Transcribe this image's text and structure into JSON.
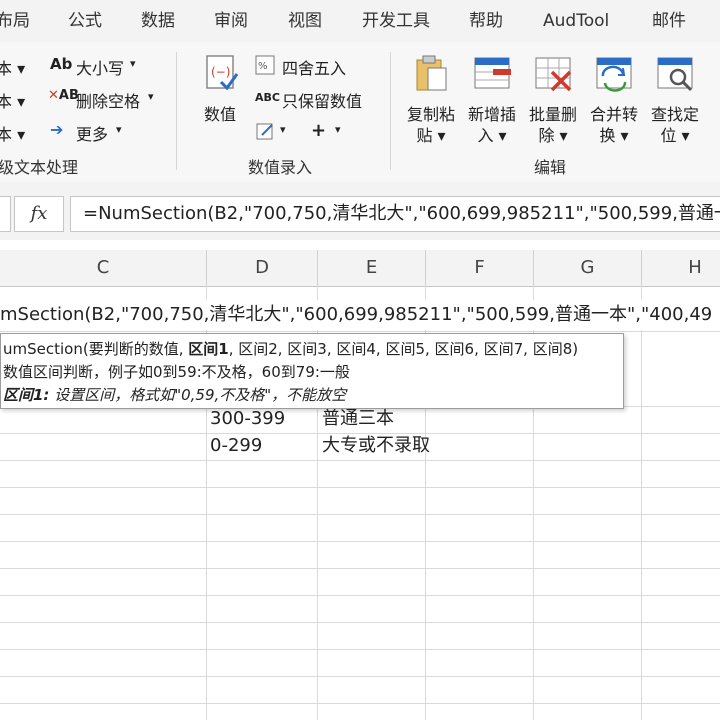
{
  "tabs": [
    "布局",
    "公式",
    "数据",
    "审阅",
    "视图",
    "开发工具",
    "帮助",
    "AudTool",
    "邮件"
  ],
  "ribbon": {
    "text_group": {
      "left_items": [
        "本 ▾",
        "本 ▾",
        "本 ▾"
      ],
      "case_label": "大小写",
      "remove_space_label": "删除空格",
      "more_label": "更多",
      "group_label": "级文本处理"
    },
    "numeric_group": {
      "value_label": "数值",
      "round_label": "四舍五入",
      "keep_value_label": "只保留数值",
      "group_label": "数值录入"
    },
    "edit_group": {
      "buttons": [
        {
          "line1": "复制粘",
          "line2": "贴 ▾",
          "icon": "paste-icon"
        },
        {
          "line1": "新增插",
          "line2": "入 ▾",
          "icon": "insert-icon"
        },
        {
          "line1": "批量删",
          "line2": "除 ▾",
          "icon": "delete-icon"
        },
        {
          "line1": "合并转",
          "line2": "换 ▾",
          "icon": "merge-icon"
        },
        {
          "line1": "查找定",
          "line2": "位 ▾",
          "icon": "find-icon"
        }
      ],
      "group_label": "编辑"
    }
  },
  "formula_bar": {
    "fx": "fx",
    "formula": "=NumSection(B2,\"700,750,清华北大\",\"600,699,985211\",\"500,599,普通一"
  },
  "grid": {
    "columns": [
      "C",
      "D",
      "E",
      "F",
      "G",
      "H"
    ],
    "editing_text": "mSection(B2,\"700,750,清华北大\",\"600,699,985211\",\"500,599,普通一本\",\"400,49",
    "rows": [
      {
        "range": "300-399",
        "label": "普通三本"
      },
      {
        "range": "0-299",
        "label": "大专或不录取"
      }
    ]
  },
  "tooltip": {
    "signature_prefix": "umSection(要判断的数值, ",
    "signature_bold": "区间1",
    "signature_suffix": ", 区间2, 区间3, 区间4, 区间5, 区间6, 区间7, 区间8)",
    "description": "数值区间判断，例子如0到59:不及格，60到79:一般",
    "param_name": "区间1:",
    "param_desc": " 设置区间，格式如\"0,59,不及格\"，不能放空"
  },
  "colors": {
    "ribbon_bg": "#f7f7f7",
    "tab_bg": "#f3f3f3",
    "grid_line": "#dadada",
    "accent_blue": "#2b6cc4",
    "accent_red": "#d03a2c"
  }
}
